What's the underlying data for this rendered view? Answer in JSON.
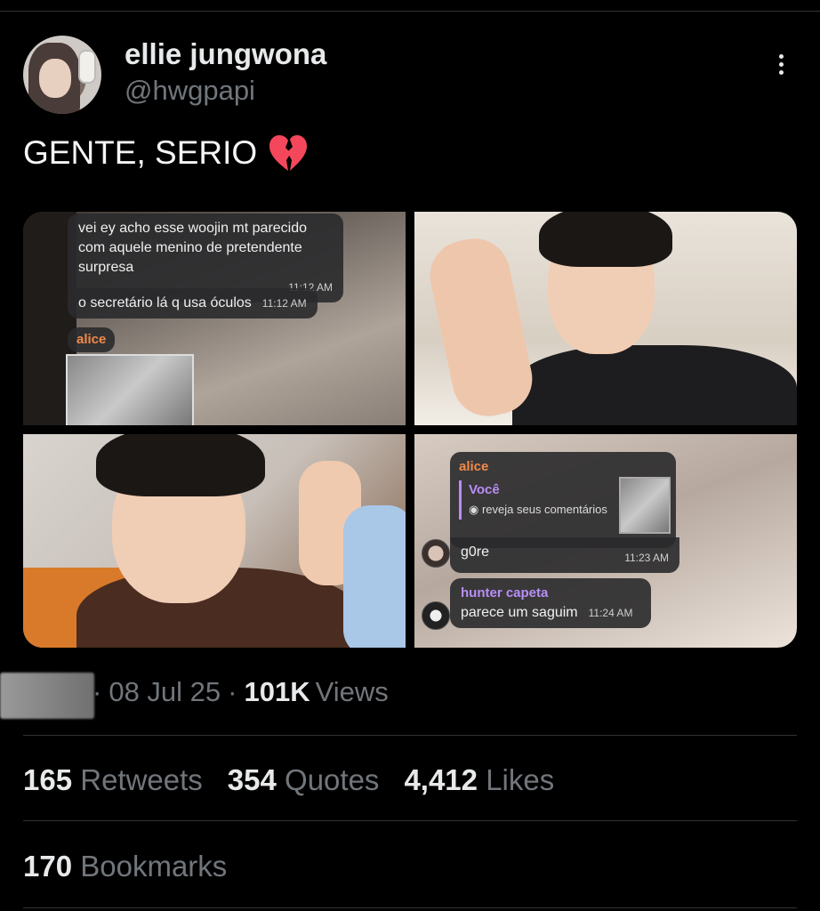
{
  "author": {
    "name": "ellie jungwona",
    "handle": "@hwgpapi"
  },
  "tweet": {
    "text": "GENTE, SERIO",
    "emoji": "broken-heart-icon"
  },
  "media": {
    "chat1": {
      "msg1": "vei ey acho esse woojin mt parecido com aquele menino de pretendente surpresa",
      "msg1_time": "11:12 AM",
      "msg2": "o secretário lá q usa óculos",
      "msg2_time": "11:12 AM",
      "sender": "alice"
    },
    "chat2": {
      "sender": "alice",
      "reply_to": "Você",
      "reply_text": "reveja seus comentários",
      "msg": "g0re",
      "msg_time": "11:23 AM",
      "sender2": "hunter capeta",
      "msg2": "parece um saguim",
      "msg2_time": "11:24 AM"
    }
  },
  "meta": {
    "date": "08 Jul 25",
    "views_count": "101K",
    "views_label": "Views"
  },
  "stats": {
    "retweets_count": "165",
    "retweets_label": "Retweets",
    "quotes_count": "354",
    "quotes_label": "Quotes",
    "likes_count": "4,412",
    "likes_label": "Likes",
    "bookmarks_count": "170",
    "bookmarks_label": "Bookmarks"
  },
  "colors": {
    "background": "#000000",
    "text": "#e7e9ea",
    "muted": "#71767b",
    "heart": "#f4475c"
  }
}
